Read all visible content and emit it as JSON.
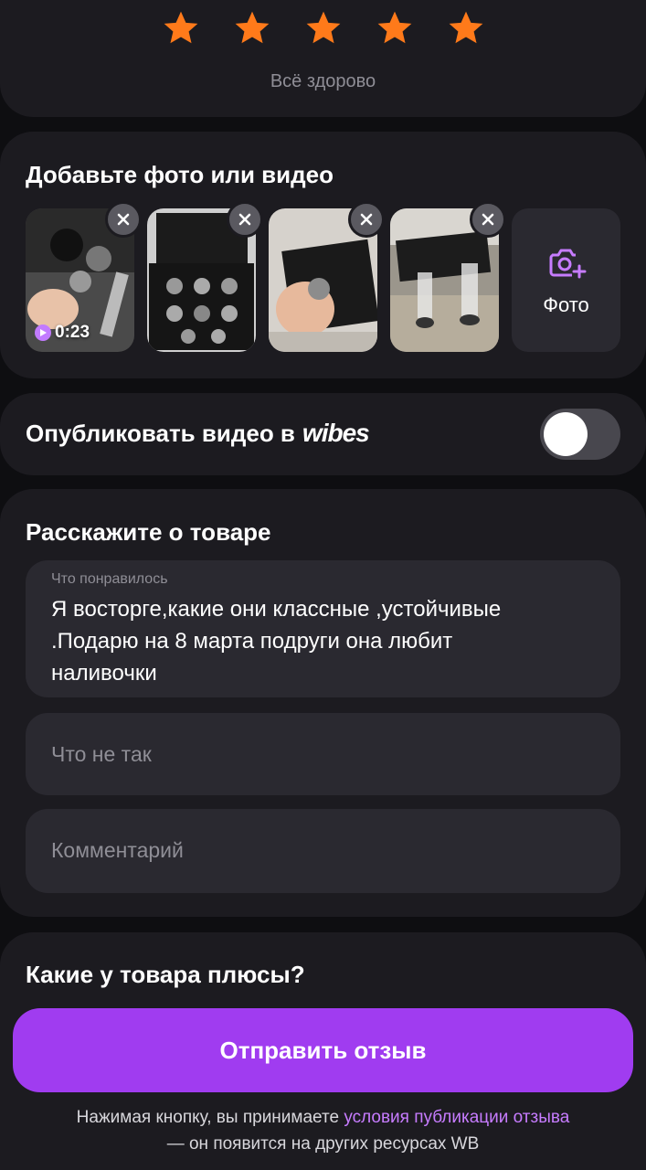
{
  "rating": {
    "stars": 5,
    "max_stars": 5,
    "star_color": "#ff7a1a",
    "caption": "Всё здорово"
  },
  "media": {
    "title": "Добавьте фото или видео",
    "items": [
      {
        "kind": "video",
        "duration": "0:23",
        "remove_icon": "close-icon"
      },
      {
        "kind": "photo",
        "remove_icon": "close-icon"
      },
      {
        "kind": "photo",
        "remove_icon": "close-icon"
      },
      {
        "kind": "photo",
        "remove_icon": "close-icon"
      }
    ],
    "add_label": "Фото",
    "add_icon": "camera-plus-icon"
  },
  "wibes": {
    "label": "Опубликовать видео в",
    "brand": "wibes",
    "enabled": false
  },
  "review": {
    "title": "Расскажите о товаре",
    "liked_label": "Что понравилось",
    "liked_value": "Я восторге,какие они классные ,устойчивые .Подарю на 8 марта подруги она любит наливочки",
    "wrong_placeholder": "Что не так",
    "comment_placeholder": "Комментарий"
  },
  "pros": {
    "title": "Какие у товара плюсы?"
  },
  "submit_label": "Отправить отзыв",
  "disclaimer": {
    "prefix": "Нажимая кнопку, вы принимаете ",
    "link": "условия публикации отзыва",
    "suffix": "— он появится на других ресурсах WB"
  },
  "colors": {
    "accent": "#a03cf0",
    "link": "#c77cff",
    "card": "#1c1b20",
    "background": "#0e0e11"
  }
}
